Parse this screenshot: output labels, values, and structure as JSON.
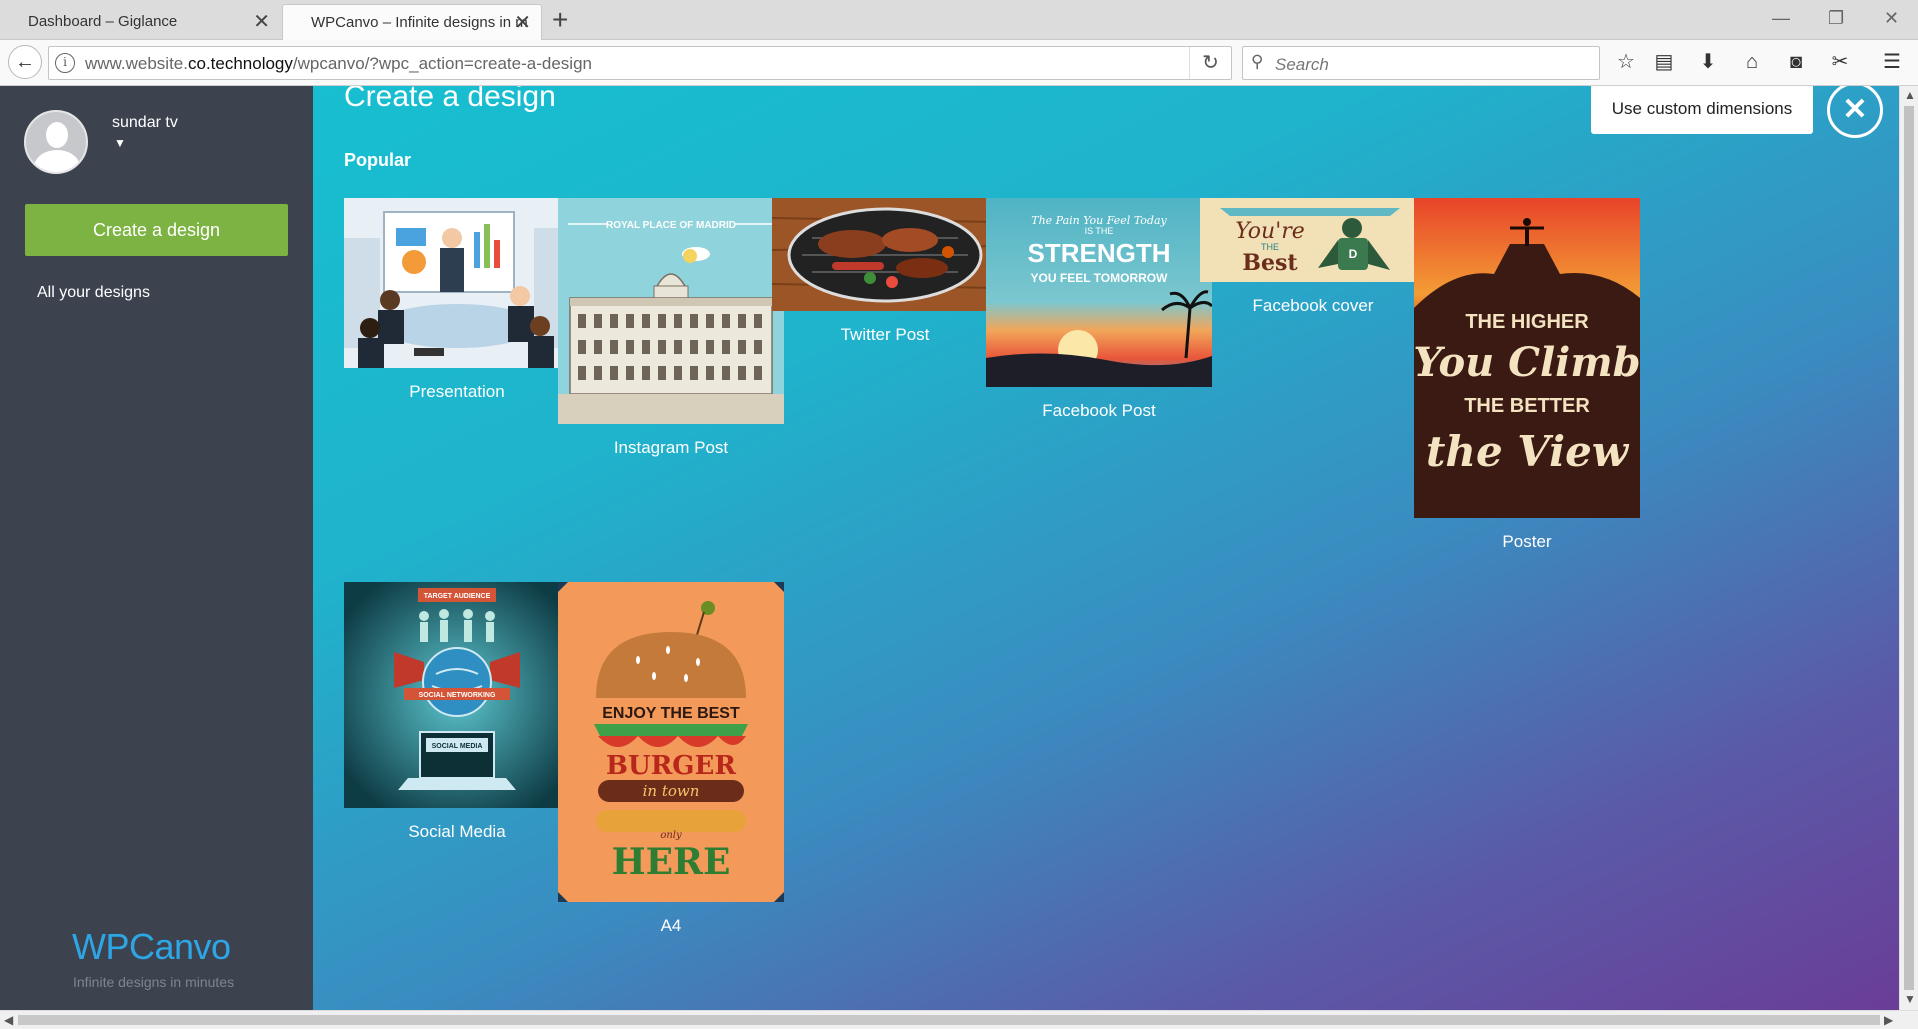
{
  "browser": {
    "tabs": [
      {
        "title": "Dashboard – Giglance"
      },
      {
        "title": "WPCanvo – Infinite designs in m"
      }
    ],
    "url_prefix": "www.website.",
    "url_domain": "co.technology",
    "url_path": "/wpcanvo/?wpc_action=create-a-design",
    "search_placeholder": "Search"
  },
  "sidebar": {
    "username": "sundar tv",
    "create_button": "Create a design",
    "all_designs": "All your designs",
    "brand": "WPCanvo",
    "tagline": "Infinite designs in minutes"
  },
  "main": {
    "heading": "Create a design",
    "section": "Popular",
    "custom_dimensions": "Use custom dimensions",
    "designs": [
      {
        "label": "Presentation"
      },
      {
        "label": "Instagram Post",
        "art_text": "ROYAL PLACE OF MADRID"
      },
      {
        "label": "Twitter Post"
      },
      {
        "label": "Facebook Post",
        "art_line1": "The Pain You Feel Today",
        "art_line2": "IS THE",
        "art_line3": "STRENGTH",
        "art_line4": "YOU FEEL TOMORROW"
      },
      {
        "label": "Facebook cover",
        "art_line1": "You're",
        "art_line2": "THE",
        "art_line3": "Best"
      },
      {
        "label": "Poster",
        "art_line1": "THE HIGHER",
        "art_line2": "You Climb",
        "art_line3": "THE BETTER",
        "art_line4": "the View"
      },
      {
        "label": "Social Media",
        "art_line1": "TARGET AUDIENCE",
        "art_line2": "SOCIAL NETWORKING",
        "art_line3": "SOCIAL MEDIA"
      },
      {
        "label": "A4",
        "art_line1": "ENJOY THE BEST",
        "art_line2": "BURGER",
        "art_line3": "in town",
        "art_line4": "only",
        "art_line5": "HERE"
      }
    ]
  },
  "colors": {
    "sidebar_bg": "#3c434f",
    "create_button": "#7cb342",
    "brand_blue": "#2ea6e6",
    "gradient_start": "#17bfd0",
    "gradient_end": "#6a3d98"
  }
}
